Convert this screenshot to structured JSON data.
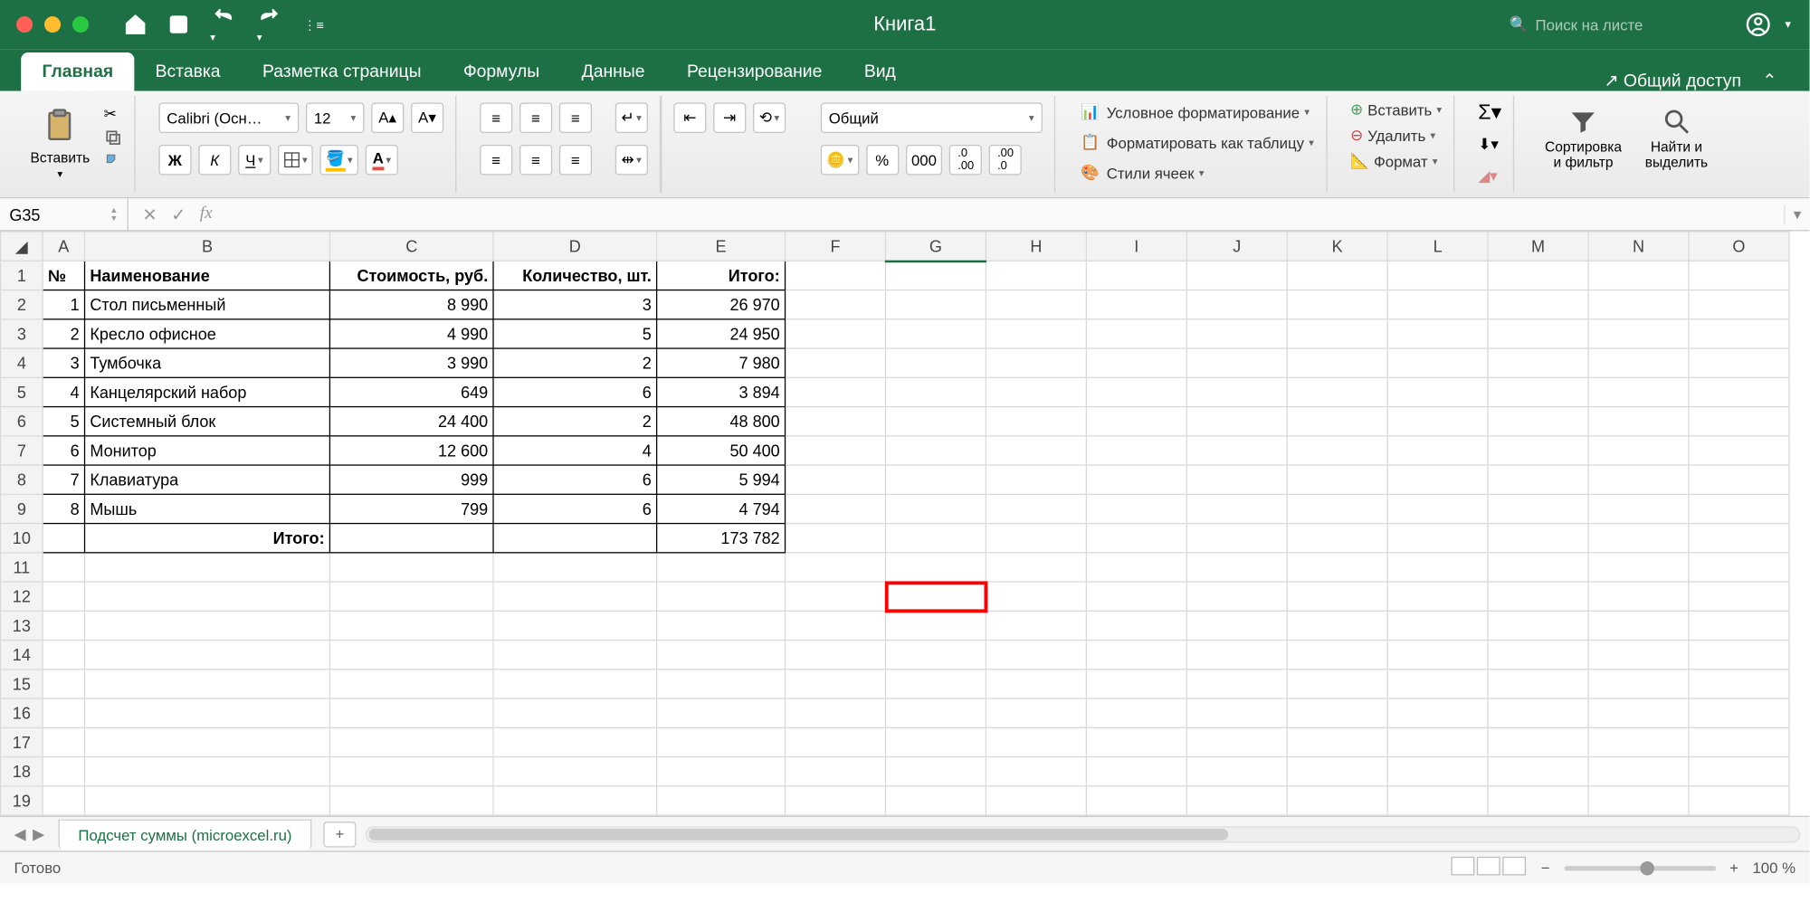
{
  "title": "Книга1",
  "search_placeholder": "Поиск на листе",
  "tabs": [
    "Главная",
    "Вставка",
    "Разметка страницы",
    "Формулы",
    "Данные",
    "Рецензирование",
    "Вид"
  ],
  "share": "Общий доступ",
  "paste_label": "Вставить",
  "font_name": "Calibri (Осн…",
  "font_size": "12",
  "bold": "Ж",
  "italic": "К",
  "underline": "Ч",
  "num_format": "Общий",
  "cond_format": "Условное форматирование",
  "format_table": "Форматировать как таблицу",
  "cell_styles": "Стили ячеек",
  "insert": "Вставить",
  "delete": "Удалить",
  "format": "Формат",
  "sort_filter": "Сортировка\nи фильтр",
  "find_select": "Найти и\nвыделить",
  "namebox": "G35",
  "columns": [
    "A",
    "B",
    "C",
    "D",
    "E",
    "F",
    "G",
    "H",
    "I",
    "J",
    "K",
    "L",
    "M",
    "N",
    "O"
  ],
  "headers": {
    "a": "№",
    "b": "Наименование",
    "c": "Стоимость, руб.",
    "d": "Количество, шт.",
    "e": "Итого:"
  },
  "rows": [
    {
      "n": "1",
      "name": "Стол письменный",
      "price": "8 990",
      "qty": "3",
      "total": "26 970"
    },
    {
      "n": "2",
      "name": "Кресло офисное",
      "price": "4 990",
      "qty": "5",
      "total": "24 950"
    },
    {
      "n": "3",
      "name": "Тумбочка",
      "price": "3 990",
      "qty": "2",
      "total": "7 980"
    },
    {
      "n": "4",
      "name": "Канцелярский набор",
      "price": "649",
      "qty": "6",
      "total": "3 894"
    },
    {
      "n": "5",
      "name": "Системный блок",
      "price": "24 400",
      "qty": "2",
      "total": "48 800"
    },
    {
      "n": "6",
      "name": "Монитор",
      "price": "12 600",
      "qty": "4",
      "total": "50 400"
    },
    {
      "n": "7",
      "name": "Клавиатура",
      "price": "999",
      "qty": "6",
      "total": "5 994"
    },
    {
      "n": "8",
      "name": "Мышь",
      "price": "799",
      "qty": "6",
      "total": "4 794"
    }
  ],
  "footer_label": "Итого:",
  "grand_total": "173 782",
  "sheet_name": "Подсчет суммы (microexcel.ru)",
  "status": "Готово",
  "zoom": "100 %"
}
